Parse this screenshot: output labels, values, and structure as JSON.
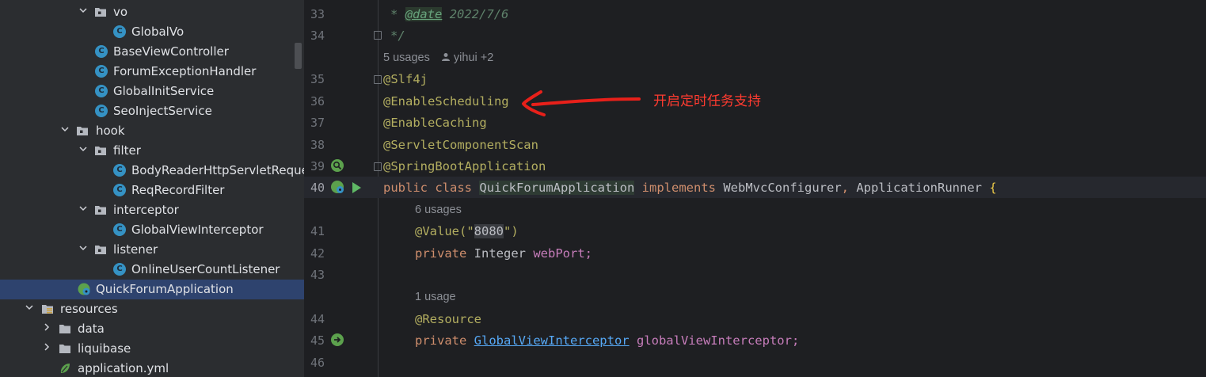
{
  "tree": {
    "items": [
      {
        "label": "vo",
        "type": "package",
        "expanded": true
      },
      {
        "label": "GlobalVo",
        "type": "class"
      },
      {
        "label": "BaseViewController",
        "type": "class"
      },
      {
        "label": "ForumExceptionHandler",
        "type": "class"
      },
      {
        "label": "GlobalInitService",
        "type": "class"
      },
      {
        "label": "SeoInjectService",
        "type": "class"
      },
      {
        "label": "hook",
        "type": "package",
        "expanded": true
      },
      {
        "label": "filter",
        "type": "package",
        "expanded": true
      },
      {
        "label": "BodyReaderHttpServletReque",
        "type": "class"
      },
      {
        "label": "ReqRecordFilter",
        "type": "class"
      },
      {
        "label": "interceptor",
        "type": "package",
        "expanded": true
      },
      {
        "label": "GlobalViewInterceptor",
        "type": "class"
      },
      {
        "label": "listener",
        "type": "package",
        "expanded": true
      },
      {
        "label": "OnlineUserCountListener",
        "type": "class"
      },
      {
        "label": "QuickForumApplication",
        "type": "spring-class",
        "selected": true
      },
      {
        "label": "resources",
        "type": "resources-folder",
        "expanded": true
      },
      {
        "label": "data",
        "type": "folder",
        "expanded": false
      },
      {
        "label": "liquibase",
        "type": "folder",
        "expanded": false
      },
      {
        "label": "application.yml",
        "type": "yml-file"
      }
    ],
    "class_icon_letter": "C"
  },
  "editor": {
    "line_numbers": [
      "33",
      "34",
      "35",
      "36",
      "37",
      "38",
      "39",
      "40",
      "41",
      "42",
      "43",
      "44",
      "45",
      "46"
    ],
    "doc_star": "*",
    "doc_tag": "@date",
    "doc_date": "2022/7/6",
    "doc_end": "*/",
    "hint1": "5 usages",
    "hint1_authors": "yihui +2",
    "ann_slf4j": "@Slf4j",
    "ann_scheduling": "@EnableScheduling",
    "ann_caching": "@EnableCaching",
    "ann_servlet": "@ServletComponentScan",
    "ann_spring": "@SpringBootApplication",
    "kw_public": "public",
    "kw_class": "class",
    "class_name": "QuickForumApplication",
    "kw_implements": "implements",
    "iface1": "WebMvcConfigurer",
    "comma": ",",
    "iface2": "ApplicationRunner",
    "brace": "{",
    "hint2": "6 usages",
    "ann_value": "@Value",
    "paren_open": "(\"",
    "value_str": "8080",
    "paren_close": "\")",
    "kw_private": "private",
    "type_integer": "Integer",
    "field_webport": "webPort;",
    "hint3": "1 usage",
    "ann_resource": "@Resource",
    "type_interceptor": "GlobalViewInterceptor",
    "field_interceptor": "globalViewInterceptor;"
  },
  "annotation": {
    "text": "开启定时任务支持",
    "color": "#ff3b30"
  },
  "colors": {
    "annotation": "#b3ae60",
    "keyword": "#cf8e6d",
    "field": "#c77dbb",
    "string": "#6aab73",
    "selection": "#2e436e"
  }
}
